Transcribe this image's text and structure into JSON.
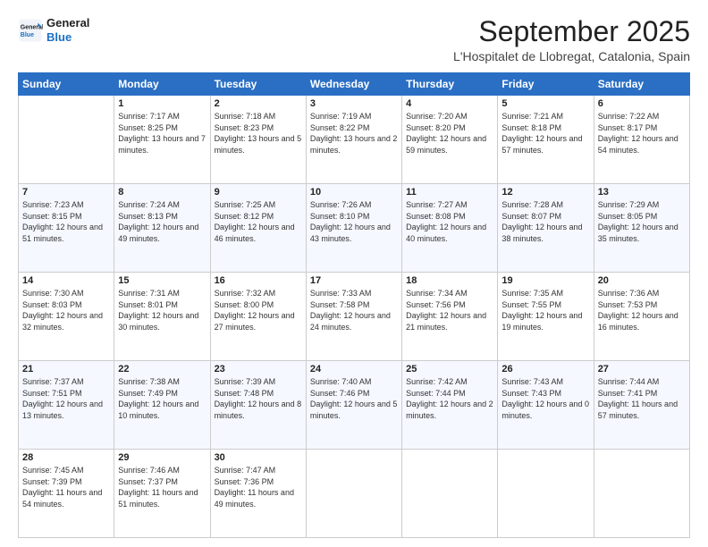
{
  "logo": {
    "line1": "General",
    "line2": "Blue"
  },
  "header": {
    "month": "September 2025",
    "location": "L'Hospitalet de Llobregat, Catalonia, Spain"
  },
  "weekdays": [
    "Sunday",
    "Monday",
    "Tuesday",
    "Wednesday",
    "Thursday",
    "Friday",
    "Saturday"
  ],
  "weeks": [
    [
      {
        "day": "",
        "sunrise": "",
        "sunset": "",
        "daylight": ""
      },
      {
        "day": "1",
        "sunrise": "Sunrise: 7:17 AM",
        "sunset": "Sunset: 8:25 PM",
        "daylight": "Daylight: 13 hours and 7 minutes."
      },
      {
        "day": "2",
        "sunrise": "Sunrise: 7:18 AM",
        "sunset": "Sunset: 8:23 PM",
        "daylight": "Daylight: 13 hours and 5 minutes."
      },
      {
        "day": "3",
        "sunrise": "Sunrise: 7:19 AM",
        "sunset": "Sunset: 8:22 PM",
        "daylight": "Daylight: 13 hours and 2 minutes."
      },
      {
        "day": "4",
        "sunrise": "Sunrise: 7:20 AM",
        "sunset": "Sunset: 8:20 PM",
        "daylight": "Daylight: 12 hours and 59 minutes."
      },
      {
        "day": "5",
        "sunrise": "Sunrise: 7:21 AM",
        "sunset": "Sunset: 8:18 PM",
        "daylight": "Daylight: 12 hours and 57 minutes."
      },
      {
        "day": "6",
        "sunrise": "Sunrise: 7:22 AM",
        "sunset": "Sunset: 8:17 PM",
        "daylight": "Daylight: 12 hours and 54 minutes."
      }
    ],
    [
      {
        "day": "7",
        "sunrise": "Sunrise: 7:23 AM",
        "sunset": "Sunset: 8:15 PM",
        "daylight": "Daylight: 12 hours and 51 minutes."
      },
      {
        "day": "8",
        "sunrise": "Sunrise: 7:24 AM",
        "sunset": "Sunset: 8:13 PM",
        "daylight": "Daylight: 12 hours and 49 minutes."
      },
      {
        "day": "9",
        "sunrise": "Sunrise: 7:25 AM",
        "sunset": "Sunset: 8:12 PM",
        "daylight": "Daylight: 12 hours and 46 minutes."
      },
      {
        "day": "10",
        "sunrise": "Sunrise: 7:26 AM",
        "sunset": "Sunset: 8:10 PM",
        "daylight": "Daylight: 12 hours and 43 minutes."
      },
      {
        "day": "11",
        "sunrise": "Sunrise: 7:27 AM",
        "sunset": "Sunset: 8:08 PM",
        "daylight": "Daylight: 12 hours and 40 minutes."
      },
      {
        "day": "12",
        "sunrise": "Sunrise: 7:28 AM",
        "sunset": "Sunset: 8:07 PM",
        "daylight": "Daylight: 12 hours and 38 minutes."
      },
      {
        "day": "13",
        "sunrise": "Sunrise: 7:29 AM",
        "sunset": "Sunset: 8:05 PM",
        "daylight": "Daylight: 12 hours and 35 minutes."
      }
    ],
    [
      {
        "day": "14",
        "sunrise": "Sunrise: 7:30 AM",
        "sunset": "Sunset: 8:03 PM",
        "daylight": "Daylight: 12 hours and 32 minutes."
      },
      {
        "day": "15",
        "sunrise": "Sunrise: 7:31 AM",
        "sunset": "Sunset: 8:01 PM",
        "daylight": "Daylight: 12 hours and 30 minutes."
      },
      {
        "day": "16",
        "sunrise": "Sunrise: 7:32 AM",
        "sunset": "Sunset: 8:00 PM",
        "daylight": "Daylight: 12 hours and 27 minutes."
      },
      {
        "day": "17",
        "sunrise": "Sunrise: 7:33 AM",
        "sunset": "Sunset: 7:58 PM",
        "daylight": "Daylight: 12 hours and 24 minutes."
      },
      {
        "day": "18",
        "sunrise": "Sunrise: 7:34 AM",
        "sunset": "Sunset: 7:56 PM",
        "daylight": "Daylight: 12 hours and 21 minutes."
      },
      {
        "day": "19",
        "sunrise": "Sunrise: 7:35 AM",
        "sunset": "Sunset: 7:55 PM",
        "daylight": "Daylight: 12 hours and 19 minutes."
      },
      {
        "day": "20",
        "sunrise": "Sunrise: 7:36 AM",
        "sunset": "Sunset: 7:53 PM",
        "daylight": "Daylight: 12 hours and 16 minutes."
      }
    ],
    [
      {
        "day": "21",
        "sunrise": "Sunrise: 7:37 AM",
        "sunset": "Sunset: 7:51 PM",
        "daylight": "Daylight: 12 hours and 13 minutes."
      },
      {
        "day": "22",
        "sunrise": "Sunrise: 7:38 AM",
        "sunset": "Sunset: 7:49 PM",
        "daylight": "Daylight: 12 hours and 10 minutes."
      },
      {
        "day": "23",
        "sunrise": "Sunrise: 7:39 AM",
        "sunset": "Sunset: 7:48 PM",
        "daylight": "Daylight: 12 hours and 8 minutes."
      },
      {
        "day": "24",
        "sunrise": "Sunrise: 7:40 AM",
        "sunset": "Sunset: 7:46 PM",
        "daylight": "Daylight: 12 hours and 5 minutes."
      },
      {
        "day": "25",
        "sunrise": "Sunrise: 7:42 AM",
        "sunset": "Sunset: 7:44 PM",
        "daylight": "Daylight: 12 hours and 2 minutes."
      },
      {
        "day": "26",
        "sunrise": "Sunrise: 7:43 AM",
        "sunset": "Sunset: 7:43 PM",
        "daylight": "Daylight: 12 hours and 0 minutes."
      },
      {
        "day": "27",
        "sunrise": "Sunrise: 7:44 AM",
        "sunset": "Sunset: 7:41 PM",
        "daylight": "Daylight: 11 hours and 57 minutes."
      }
    ],
    [
      {
        "day": "28",
        "sunrise": "Sunrise: 7:45 AM",
        "sunset": "Sunset: 7:39 PM",
        "daylight": "Daylight: 11 hours and 54 minutes."
      },
      {
        "day": "29",
        "sunrise": "Sunrise: 7:46 AM",
        "sunset": "Sunset: 7:37 PM",
        "daylight": "Daylight: 11 hours and 51 minutes."
      },
      {
        "day": "30",
        "sunrise": "Sunrise: 7:47 AM",
        "sunset": "Sunset: 7:36 PM",
        "daylight": "Daylight: 11 hours and 49 minutes."
      },
      {
        "day": "",
        "sunrise": "",
        "sunset": "",
        "daylight": ""
      },
      {
        "day": "",
        "sunrise": "",
        "sunset": "",
        "daylight": ""
      },
      {
        "day": "",
        "sunrise": "",
        "sunset": "",
        "daylight": ""
      },
      {
        "day": "",
        "sunrise": "",
        "sunset": "",
        "daylight": ""
      }
    ]
  ]
}
